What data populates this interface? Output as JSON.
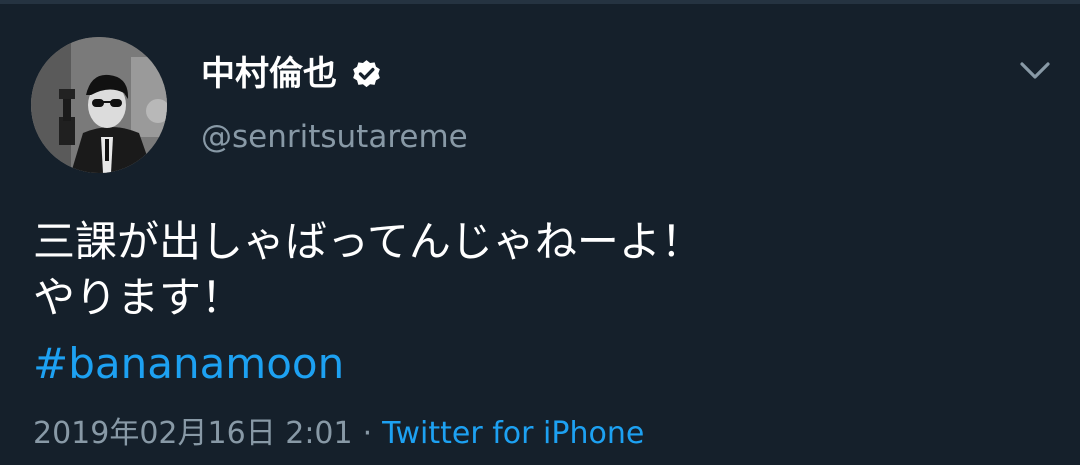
{
  "tweet": {
    "author": {
      "display_name": "中村倫也",
      "handle": "@senritsutareme",
      "verified": true,
      "avatar_icon": "profile-photo-avatar"
    },
    "text_lines": [
      "三課が出しゃばってんじゃねーよ！",
      "やります！"
    ],
    "hashtag": "#bananamoon",
    "timestamp": "2019年02月16日 2:01",
    "separator": "·",
    "source": "Twitter for iPhone",
    "menu_icon": "chevron-down-icon"
  },
  "colors": {
    "background": "#15202b",
    "primary_text": "#ffffff",
    "secondary_text": "#8899a6",
    "link": "#1da1f2"
  }
}
